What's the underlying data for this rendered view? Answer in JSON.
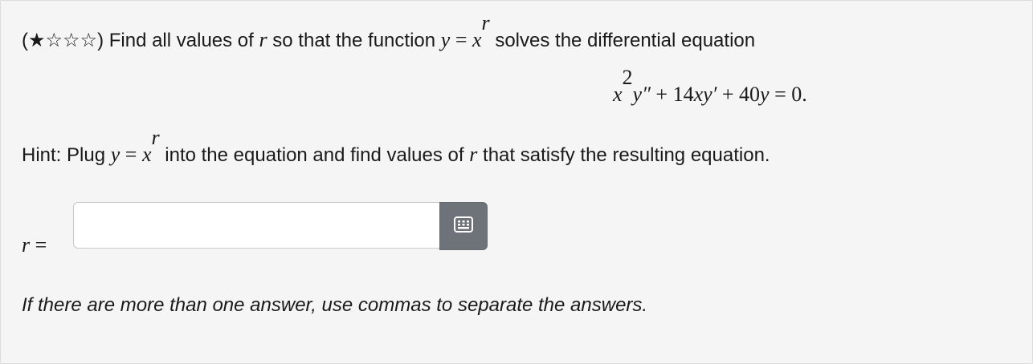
{
  "question": {
    "stars": "★☆☆☆",
    "open_paren": "(",
    "close_paren": ")",
    "text_before_r": " Find all values of ",
    "var_r": "r",
    "text_mid": " so that the function ",
    "func_y": "y",
    "equals": " = ",
    "func_x": "x",
    "func_exp": "r",
    "text_after": " solves the differential equation"
  },
  "equation": {
    "x": "x",
    "x_exp": "2",
    "y2": "y″",
    "plus1": " + ",
    "coef1": "14",
    "xy": "xy′",
    "plus2": " + ",
    "coef2": "40",
    "y": "y",
    "eq": " = ",
    "rhs": "0."
  },
  "hint": {
    "prefix": "Hint: Plug ",
    "y": "y",
    "equals": " = ",
    "x": "x",
    "exp": "r",
    "middle": " into the equation and find values of ",
    "r": "r",
    "suffix": " that satisfy the resulting equation."
  },
  "answer": {
    "label_var": "r",
    "label_eq": " =",
    "value": "",
    "placeholder": ""
  },
  "keypad_button": {
    "icon": "keyboard-grid-icon"
  },
  "note": "If there are more than one answer, use commas to separate the answers."
}
